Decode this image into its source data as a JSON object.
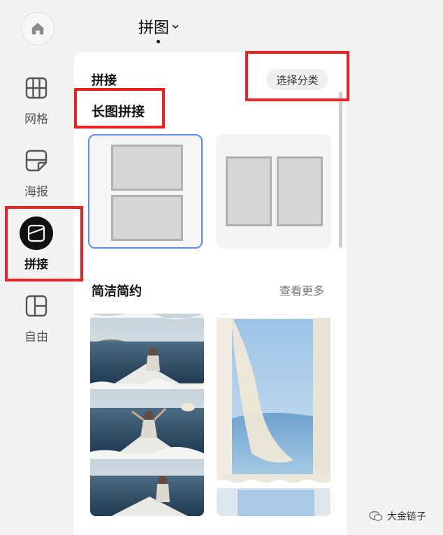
{
  "header": {
    "title": "拼图"
  },
  "sidebar": {
    "items": [
      {
        "label": "网格",
        "icon": "grid-icon",
        "active": false
      },
      {
        "label": "海报",
        "icon": "poster-icon",
        "active": false
      },
      {
        "label": "拼接",
        "icon": "splice-icon",
        "active": true
      },
      {
        "label": "自由",
        "icon": "freeform-icon",
        "active": false
      }
    ]
  },
  "panel": {
    "section_label": "拼接",
    "filter_chip": "选择分类",
    "subsection_title": "长图拼接",
    "templates": [
      {
        "name": "vertical-two-rows",
        "selected": true
      },
      {
        "name": "horizontal-two-columns",
        "selected": false
      }
    ],
    "style_section": {
      "title": "简洁简约",
      "more_link": "查看更多"
    }
  },
  "watermark": {
    "text": "大金链子"
  },
  "colors": {
    "accent_border": "#5b8dea",
    "highlight_red": "#ee2222",
    "active_nav_bg": "#111111",
    "panel_bg": "#ffffff",
    "page_bg": "#f3f3f3"
  }
}
